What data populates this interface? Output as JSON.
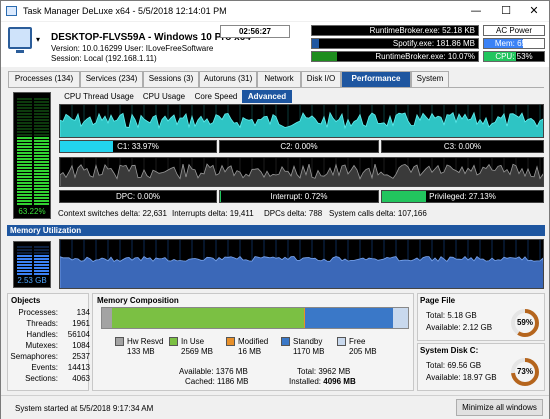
{
  "window": {
    "title": "Task Manager DeLuxe x64 - 5/5/2018 12:14:01 PM"
  },
  "header": {
    "host": "DESKTOP-FLVS59A - Windows 10 Pro x64",
    "version": "Version: 10.0.16299   User: ILoveFreeSoftware",
    "session": "Session: Local (192.168.1.11)",
    "uptime": "02:56:27",
    "top_procs": [
      {
        "label": "RuntimeBroker.exe: 52.18 KB",
        "fill": 0.0,
        "color": "#1e56a0"
      },
      {
        "label": "Spotify.exe: 181.86 MB",
        "fill": 0.04,
        "color": "#1e56a0"
      },
      {
        "label": "RuntimeBroker.exe: 10.07%",
        "fill": 0.15,
        "color": "#1e8d1e"
      }
    ],
    "power": [
      {
        "label": "AC Power",
        "fill": 0,
        "bg": "#ffffff",
        "fillcolor": "#ffffff",
        "fg": "#000000"
      },
      {
        "label": "Mem: 65%",
        "fill": 0.65,
        "bg": "#ffffff",
        "fillcolor": "#3b82f6",
        "fg": "#ffffff"
      },
      {
        "label": "CPU: 53%",
        "fill": 0.53,
        "bg": "#000000",
        "fillcolor": "#22c55e",
        "fg": "#ffffff"
      }
    ]
  },
  "tabs": [
    {
      "label": "Processes (134)"
    },
    {
      "label": "Services (234)"
    },
    {
      "label": "Sessions (3)"
    },
    {
      "label": "Autoruns (31)"
    },
    {
      "label": "Network"
    },
    {
      "label": "Disk I/O"
    },
    {
      "label": "Performance",
      "active": true
    },
    {
      "label": "System"
    }
  ],
  "cpu": {
    "total_label": "63.22%",
    "total_value": 0.6322,
    "subtabs": [
      {
        "label": "CPU Thread Usage"
      },
      {
        "label": "CPU Usage"
      },
      {
        "label": "Core Speed"
      },
      {
        "label": "Advanced",
        "active": true
      }
    ],
    "cores": [
      {
        "label": "C1: 33.97%",
        "fill": 0.3397,
        "color": "#22d3ee"
      },
      {
        "label": "C2: 0.00%",
        "fill": 0,
        "color": "#22d3ee"
      },
      {
        "label": "C3: 0.00%",
        "fill": 0,
        "color": "#22d3ee"
      }
    ],
    "times": [
      {
        "label": "DPC: 0.00%",
        "fill": 0,
        "color": "#22c55e"
      },
      {
        "label": "Interrupt: 0.72%",
        "fill": 0.0072,
        "color": "#22c55e"
      },
      {
        "label": "Privileged: 27.13%",
        "fill": 0.2713,
        "color": "#22c55e"
      }
    ],
    "stats": [
      "Context switches delta: 22,631",
      "Interrupts delta: 19,411",
      "DPCs delta: 788",
      "System calls delta: 107,166"
    ]
  },
  "memory": {
    "section_title": "Memory Utilization",
    "meter_label": "2.53 GB",
    "meter_value": 0.65
  },
  "objects": {
    "title": "Objects",
    "rows": [
      {
        "k": "Processes:",
        "v": "134"
      },
      {
        "k": "Threads:",
        "v": "1961"
      },
      {
        "k": "Handles:",
        "v": "56104"
      },
      {
        "k": "Mutexes:",
        "v": "1084"
      },
      {
        "k": "Semaphores:",
        "v": "2537"
      },
      {
        "k": "Events:",
        "v": "14413"
      },
      {
        "k": "Sections:",
        "v": "4063"
      }
    ]
  },
  "composition": {
    "title": "Memory Composition",
    "segments": [
      {
        "name": "Hw Resvd",
        "value": "133 MB",
        "mb": 133,
        "color": "#a3a3a3"
      },
      {
        "name": "In Use",
        "value": "2569 MB",
        "mb": 2569,
        "color": "#7bc043"
      },
      {
        "name": "Modified",
        "value": "16 MB",
        "mb": 16,
        "color": "#e8902a"
      },
      {
        "name": "Standby",
        "value": "1170 MB",
        "mb": 1170,
        "color": "#3a78c8"
      },
      {
        "name": "Free",
        "value": "205 MB",
        "mb": 205,
        "color": "#c9d9ee"
      }
    ],
    "available": "Available: 1376 MB",
    "cached": "Cached: 1186 MB",
    "total": "Total: 3962 MB",
    "installed_label": "Installed:",
    "installed_value": "4096 MB"
  },
  "pagefile": {
    "title": "Page File",
    "total": "Total: 5.18 GB",
    "available": "Available: 2.12 GB",
    "percent_label": "59%",
    "percent": 0.59
  },
  "systemdisk": {
    "title": "System Disk C:",
    "total": "Total: 69.56 GB",
    "available": "Available: 18.97 GB",
    "percent_label": "73%",
    "percent": 0.73
  },
  "status": {
    "started": "System started at 5/5/2018 9:17:34 AM",
    "minimize_all": "Minimize all windows"
  }
}
